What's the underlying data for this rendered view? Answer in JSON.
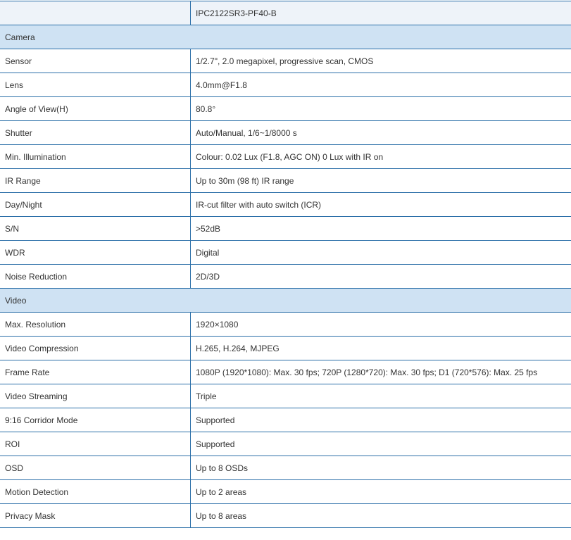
{
  "header": {
    "model": "IPC2122SR3-PF40-B"
  },
  "sections": [
    {
      "title": "Camera",
      "rows": [
        {
          "label": "Sensor",
          "value": "1/2.7\", 2.0 megapixel, progressive scan, CMOS"
        },
        {
          "label": "Lens",
          "value": "4.0mm@F1.8"
        },
        {
          "label": "Angle of View(H)",
          "value": "80.8°"
        },
        {
          "label": "Shutter",
          "value": "Auto/Manual, 1/6~1/8000 s"
        },
        {
          "label": "Min. Illumination",
          "value": "Colour: 0.02 Lux (F1.8, AGC ON) 0 Lux with IR on"
        },
        {
          "label": "IR Range",
          "value": "Up to 30m (98 ft) IR range"
        },
        {
          "label": "Day/Night",
          "value": "IR-cut filter with auto switch (ICR)"
        },
        {
          "label": "S/N",
          "value": ">52dB"
        },
        {
          "label": "WDR",
          "value": "Digital"
        },
        {
          "label": "Noise Reduction",
          "value": "2D/3D"
        }
      ]
    },
    {
      "title": "Video",
      "rows": [
        {
          "label": "Max. Resolution",
          "value": "1920×1080"
        },
        {
          "label": "Video Compression",
          "value": "H.265, H.264, MJPEG"
        },
        {
          "label": "Frame Rate",
          "value": "1080P (1920*1080): Max. 30 fps; 720P (1280*720): Max. 30 fps; D1 (720*576): Max. 25 fps"
        },
        {
          "label": "Video Streaming",
          "value": "Triple"
        },
        {
          "label": "9:16 Corridor Mode",
          "value": "Supported"
        },
        {
          "label": "ROI",
          "value": "Supported"
        },
        {
          "label": "OSD",
          "value": "Up to 8 OSDs"
        },
        {
          "label": "Motion Detection",
          "value": "Up to 2 areas"
        },
        {
          "label": "Privacy Mask",
          "value": "Up to 8 areas"
        }
      ]
    }
  ]
}
